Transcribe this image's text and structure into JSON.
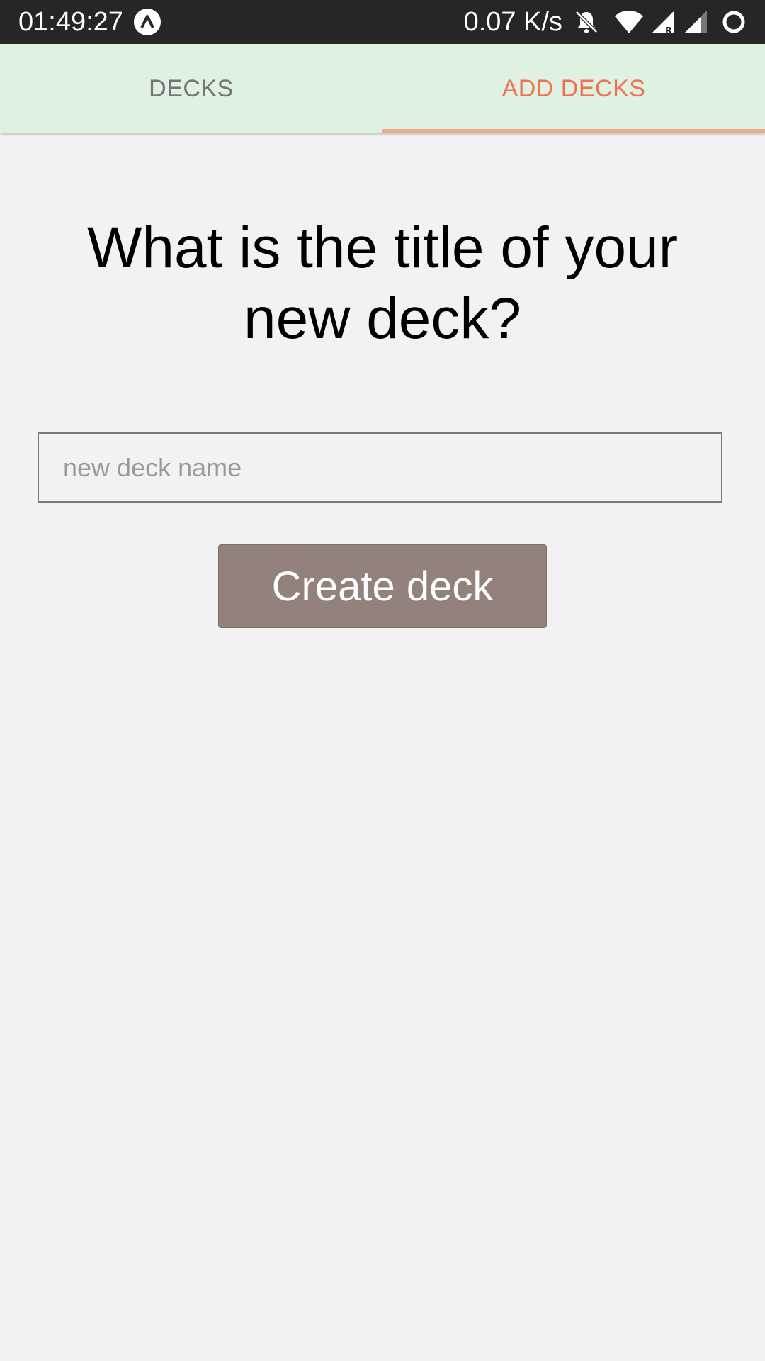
{
  "status_bar": {
    "time": "01:49:27",
    "network_speed": "0.07 K/s",
    "icons": [
      "app-notification-icon",
      "bell-off-icon",
      "wifi-icon",
      "signal-roaming-icon",
      "signal-icon",
      "sync-icon"
    ]
  },
  "tabs": [
    {
      "label": "DECKS",
      "active": false
    },
    {
      "label": "ADD DECKS",
      "active": true
    }
  ],
  "colors": {
    "tab_bar_bg": "#dff1e1",
    "active_tab": "#f0704f",
    "indicator": "#f0a989",
    "button_bg": "#93827b",
    "page_bg": "#f2f2f2"
  },
  "form": {
    "heading": "What is the title of your new deck?",
    "input_value": "",
    "input_placeholder": "new deck name",
    "submit_label": "Create deck"
  }
}
